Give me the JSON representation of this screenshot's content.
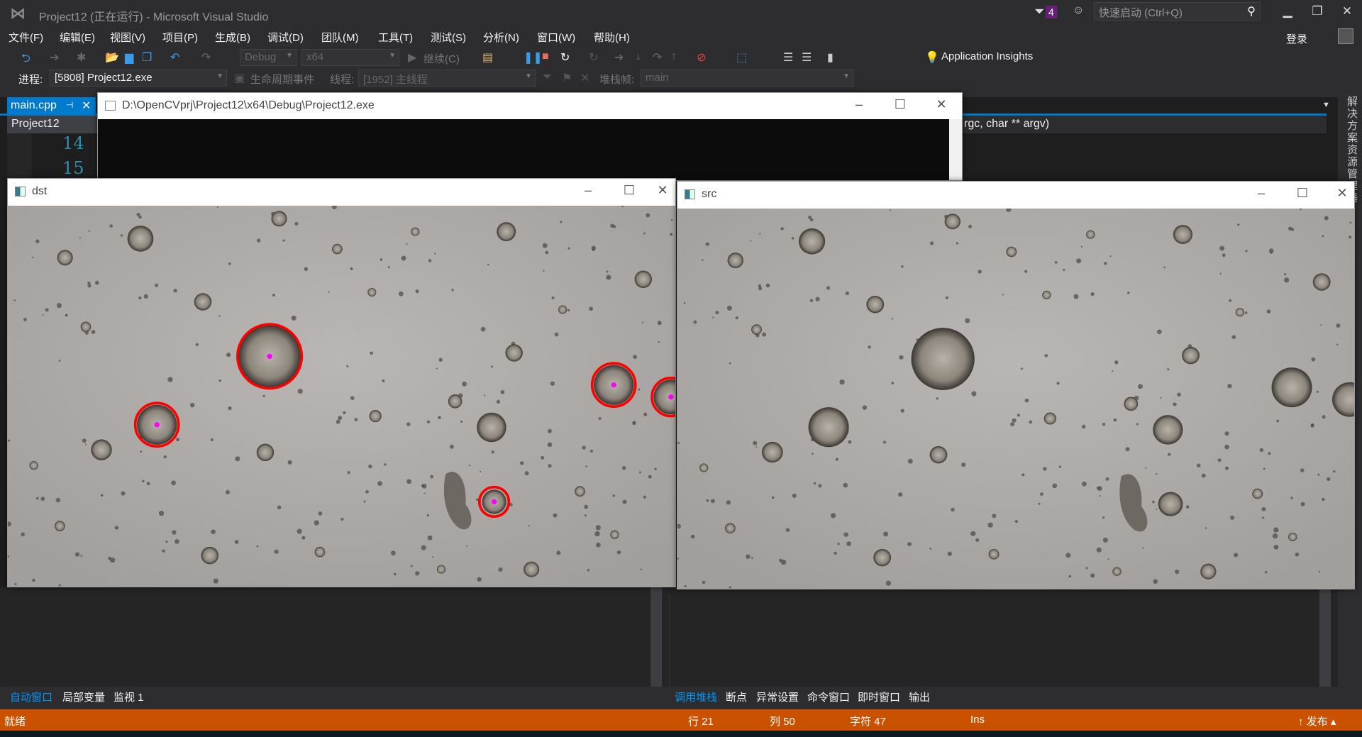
{
  "app": {
    "title": "Project12 (正在运行) - Microsoft Visual Studio",
    "notification_count": "4",
    "quick_launch_placeholder": "快速启动 (Ctrl+Q)",
    "login": "登录"
  },
  "menu": [
    "文件(F)",
    "编辑(E)",
    "视图(V)",
    "项目(P)",
    "生成(B)",
    "调试(D)",
    "团队(M)",
    "工具(T)",
    "测试(S)",
    "分析(N)",
    "窗口(W)",
    "帮助(H)"
  ],
  "toolbar": {
    "config": "Debug",
    "platform": "x64",
    "continue": "继续(C)",
    "app_insights": "Application Insights"
  },
  "debug_toolbar": {
    "process_label": "进程:",
    "process": "[5808] Project12.exe",
    "lifecycle": "生命周期事件",
    "thread_label": "线程:",
    "thread": "[1952] 主线程",
    "stack_label": "堆栈帧:",
    "stack": "main"
  },
  "editor": {
    "tab": "main.cpp",
    "project": "Project12",
    "function": "rgc, char ** argv)",
    "line_numbers": [
      "14",
      "15"
    ]
  },
  "side_tab": "解决方案资源管理器",
  "windows": {
    "console": "D:\\OpenCVprj\\Project12\\x64\\Debug\\Project12.exe",
    "dst": "dst",
    "src": "src"
  },
  "colors": {
    "accent": "#007acc",
    "status": "#ca5100",
    "detection_ring": "#ff0000",
    "detection_center": "#ff00ff"
  },
  "bottom_left_tabs": [
    "自动窗口",
    "局部变量",
    "监视 1"
  ],
  "bottom_right_tabs": [
    "调用堆栈",
    "断点",
    "异常设置",
    "命令窗口",
    "即时窗口",
    "输出"
  ],
  "status": {
    "ready": "就绪",
    "line": "行 21",
    "col": "列 50",
    "char": "字符 47",
    "mode": "Ins",
    "publish": "↑ 发布 ▴"
  }
}
